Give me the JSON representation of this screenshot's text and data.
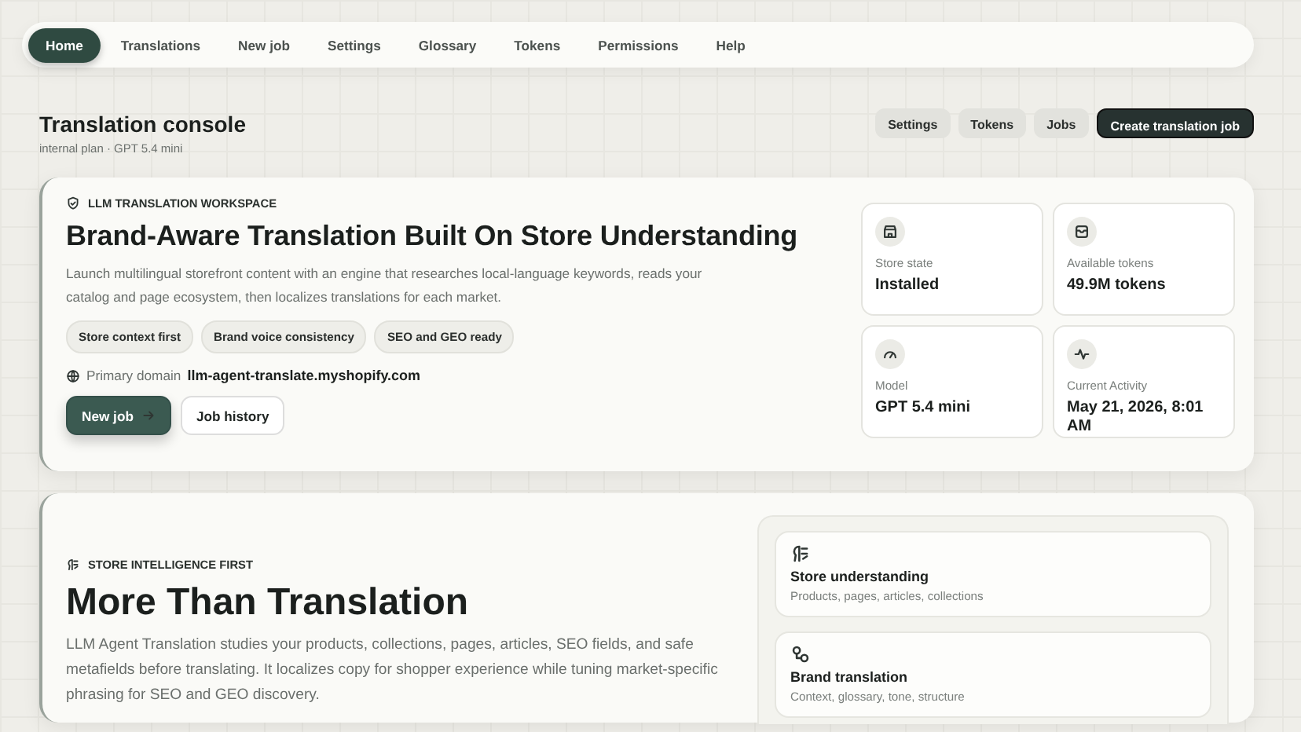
{
  "nav": [
    {
      "label": "Home",
      "selected": true
    },
    {
      "label": "Translations",
      "selected": false
    },
    {
      "label": "New job",
      "selected": false
    },
    {
      "label": "Settings",
      "selected": false
    },
    {
      "label": "Glossary",
      "selected": false
    },
    {
      "label": "Tokens",
      "selected": false
    },
    {
      "label": "Permissions",
      "selected": false
    },
    {
      "label": "Help",
      "selected": false
    }
  ],
  "header": {
    "title": "Translation console",
    "subtitle": "internal plan · GPT 5.4 mini",
    "actions": [
      {
        "label": "Settings",
        "primary": false
      },
      {
        "label": "Tokens",
        "primary": false
      },
      {
        "label": "Jobs",
        "primary": false
      },
      {
        "label": "Create translation job",
        "primary": true
      }
    ]
  },
  "hero": {
    "eyebrow": "LLM TRANSLATION WORKSPACE",
    "title": "Brand-Aware Translation Built On Store Understanding",
    "description": "Launch multilingual storefront content with an engine that researches local-language keywords, reads your catalog and page ecosystem, then localizes translations for each market.",
    "chips": [
      "Store context first",
      "Brand voice consistency",
      "SEO and GEO ready"
    ],
    "domain_label": "Primary domain",
    "domain": "llm-agent-translate.myshopify.com",
    "buttons": [
      {
        "label": "New job",
        "primary": true
      },
      {
        "label": "Job history",
        "primary": false
      }
    ],
    "stats": [
      {
        "kind": "store",
        "label": "Store state",
        "value": "Installed"
      },
      {
        "kind": "tokens",
        "label": "Available tokens",
        "value": "49.9M tokens"
      },
      {
        "kind": "model",
        "label": "Model",
        "value": "GPT 5.4 mini"
      },
      {
        "kind": "activity",
        "label": "Current Activity",
        "value": "May 21, 2026, 8:01 AM"
      }
    ]
  },
  "intelligence": {
    "eyebrow": "STORE INTELLIGENCE FIRST",
    "title": "More Than Translation",
    "description": "LLM Agent Translation studies your products, collections, pages, articles, SEO fields, and safe metafields before translating. It localizes copy for shopper experience while tuning market-specific phrasing for SEO and GEO discovery.",
    "steps": [
      {
        "kind": "understanding",
        "title": "Store understanding",
        "detail": "Products, pages, articles, collections"
      },
      {
        "kind": "translation",
        "title": "Brand translation",
        "detail": "Context, glossary, tone, structure"
      }
    ]
  }
}
